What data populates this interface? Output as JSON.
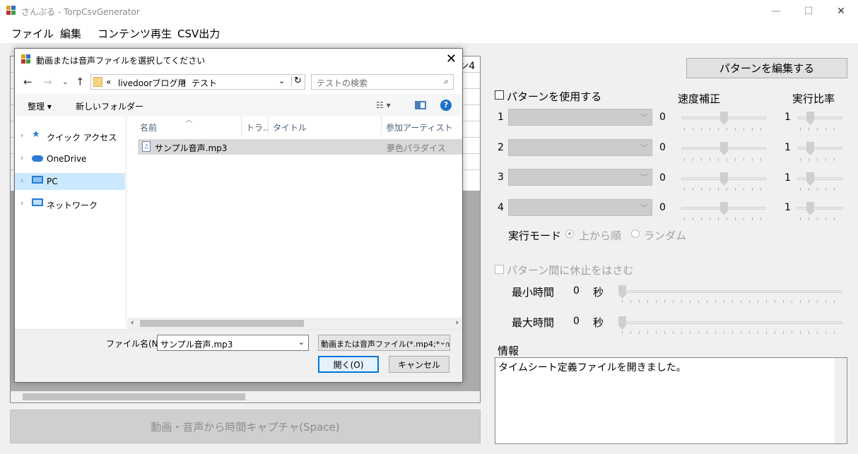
{
  "window": {
    "title": "さんぷる - TorpCsvGenerator",
    "minimize": "—",
    "maximize": "☐",
    "close": "✕"
  },
  "menu": [
    "ファイル",
    "編集",
    "コンテンツ再生",
    "CSV出力"
  ],
  "grid": {
    "header_fragment": "ーン4"
  },
  "capture_button": "動画・音声から時間キャプチャ(Space)",
  "edit_pattern_button": "パターンを編集する",
  "use_pattern_label": "パターンを使用する",
  "speed_label": "速度補正",
  "ratio_label": "実行比率",
  "patterns": [
    {
      "num": "1",
      "speed": "0",
      "ratio": "1"
    },
    {
      "num": "2",
      "speed": "0",
      "ratio": "1"
    },
    {
      "num": "3",
      "speed": "0",
      "ratio": "1"
    },
    {
      "num": "4",
      "speed": "0",
      "ratio": "1"
    }
  ],
  "mode": {
    "label": "実行モード",
    "options": [
      "上から順",
      "ランダム"
    ],
    "selected": "上から順"
  },
  "pause_label": "パターン間に休止をはさむ",
  "min_time": {
    "label": "最小時間",
    "value": "0",
    "unit": "秒"
  },
  "max_time": {
    "label": "最大時間",
    "value": "0",
    "unit": "秒"
  },
  "info": {
    "label": "情報",
    "text": "タイムシート定義ファイルを開きました。"
  },
  "dialog": {
    "title": "動画または音声ファイルを選択してください",
    "close": "✕",
    "path": {
      "prefix": "«",
      "segments": [
        "livedoorブログ用",
        "テスト"
      ],
      "sep": "›"
    },
    "search_placeholder": "テストの検索",
    "toolbar": {
      "organize": "整理 ▾",
      "new_folder": "新しいフォルダー",
      "help": "?"
    },
    "nav": [
      {
        "label": "クイック アクセス",
        "icon": "star-icon"
      },
      {
        "label": "OneDrive",
        "icon": "cloud-icon"
      },
      {
        "label": "PC",
        "icon": "pc-icon",
        "selected": true
      },
      {
        "label": "ネットワーク",
        "icon": "network-icon"
      }
    ],
    "columns": [
      "名前",
      "トラ...",
      "タイトル",
      "参加アーティスト"
    ],
    "files": [
      {
        "name": "サンプル音声.mp3",
        "artist": "夢色パラダイス",
        "icon": "audio-file-icon"
      }
    ],
    "filename_label": "ファイル名(N):",
    "filename_value": "サンプル音声.mp3",
    "filetype": "動画または音声ファイル(*.mp4;*.m",
    "open_button": "開く(O)",
    "cancel_button": "キャンセル"
  }
}
